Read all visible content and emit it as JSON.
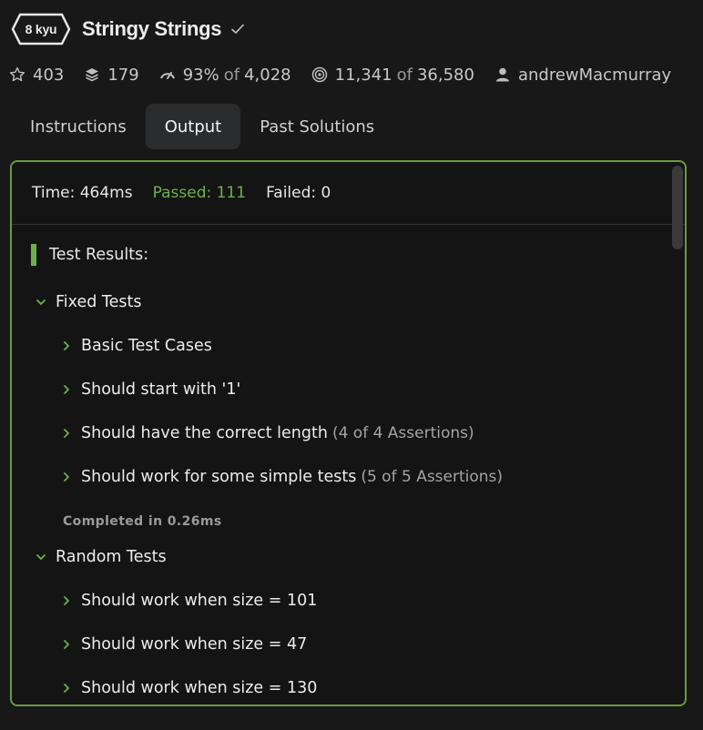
{
  "kata": {
    "rank": "8 kyu",
    "title": "Stringy Strings"
  },
  "stats": {
    "stars": "403",
    "collections": "179",
    "satisfaction": "93%",
    "satisfaction_of": "of",
    "satisfaction_total": "4,028",
    "completed": "11,341",
    "completed_of": "of",
    "completed_total": "36,580",
    "author": "andrewMacmurray"
  },
  "tabs": [
    {
      "label": "Instructions",
      "active": false
    },
    {
      "label": "Output",
      "active": true
    },
    {
      "label": "Past Solutions",
      "active": false
    }
  ],
  "summary": {
    "time": "Time: 464ms",
    "passed": "Passed: 111",
    "failed": "Failed: 0"
  },
  "results": {
    "heading": "Test Results:",
    "groups": [
      {
        "label": "Fixed Tests",
        "items": [
          {
            "label": "Basic Test Cases",
            "assertions": ""
          },
          {
            "label": "Should start with '1'",
            "assertions": ""
          },
          {
            "label": "Should have the correct length",
            "assertions": "(4 of 4 Assertions)"
          },
          {
            "label": "Should work for some simple tests",
            "assertions": "(5 of 5 Assertions)"
          }
        ],
        "completed": "Completed in 0.26ms"
      },
      {
        "label": "Random Tests",
        "items": [
          {
            "label": "Should work when size = 101",
            "assertions": ""
          },
          {
            "label": "Should work when size = 47",
            "assertions": ""
          },
          {
            "label": "Should work when size = 130",
            "assertions": ""
          }
        ]
      }
    ]
  },
  "colors": {
    "accent_green": "#6cb24a",
    "panel_border": "#6a9a3e",
    "background": "#181818"
  }
}
